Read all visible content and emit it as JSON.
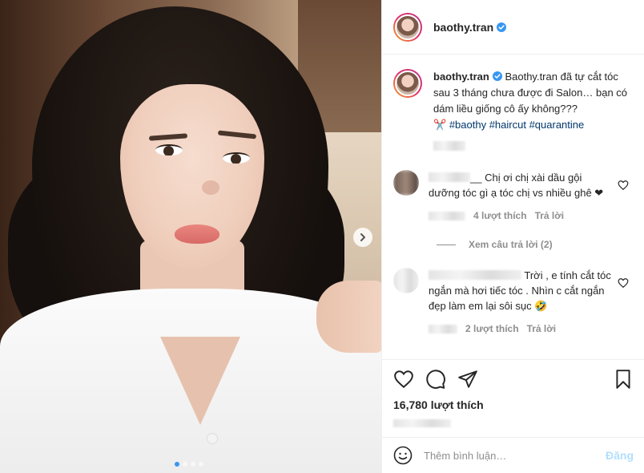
{
  "post": {
    "author": "baothy.tran",
    "verified": true,
    "caption": {
      "text_line": "Baothy.tran đã tự cắt tóc sau 3 tháng chưa được đi Salon… bạn có dám liều giống cô ấy không???",
      "emoji": "✂️",
      "hashtags": [
        "#baothy",
        "#haircut",
        "#quarantine"
      ]
    },
    "likes_text": "16,780 lượt thích"
  },
  "comments": [
    {
      "username_suffix": "__",
      "text": "Chị ơi chị xài dầu gội dưỡng tóc gì ạ tóc chị vs nhiều ghê ❤",
      "likes": "4 lượt thích",
      "reply_label": "Trả lời",
      "view_replies": "Xem câu trả lời (2)"
    },
    {
      "username_suffix": "",
      "text": "Trời , e tính cắt tóc ngắn mà hơi tiếc tóc . Nhìn c cắt ngắn đẹp làm em lại sôi sục 🤣",
      "likes": "2 lượt thích",
      "reply_label": "Trả lời"
    }
  ],
  "comment_box": {
    "placeholder": "Thêm bình luận…",
    "post_label": "Đăng"
  },
  "icons": {
    "verified": "verified-badge-icon",
    "heart": "heart-icon",
    "comment": "comment-icon",
    "share": "share-icon",
    "save": "bookmark-icon",
    "emoji": "emoji-icon",
    "next": "chevron-right-icon"
  },
  "colors": {
    "verified": "#3897f0",
    "hashtag": "#00376b",
    "post_disabled": "#b2dffc",
    "muted": "#8e8e8e"
  },
  "carousel": {
    "slide_count": 4,
    "active_index": 0
  }
}
